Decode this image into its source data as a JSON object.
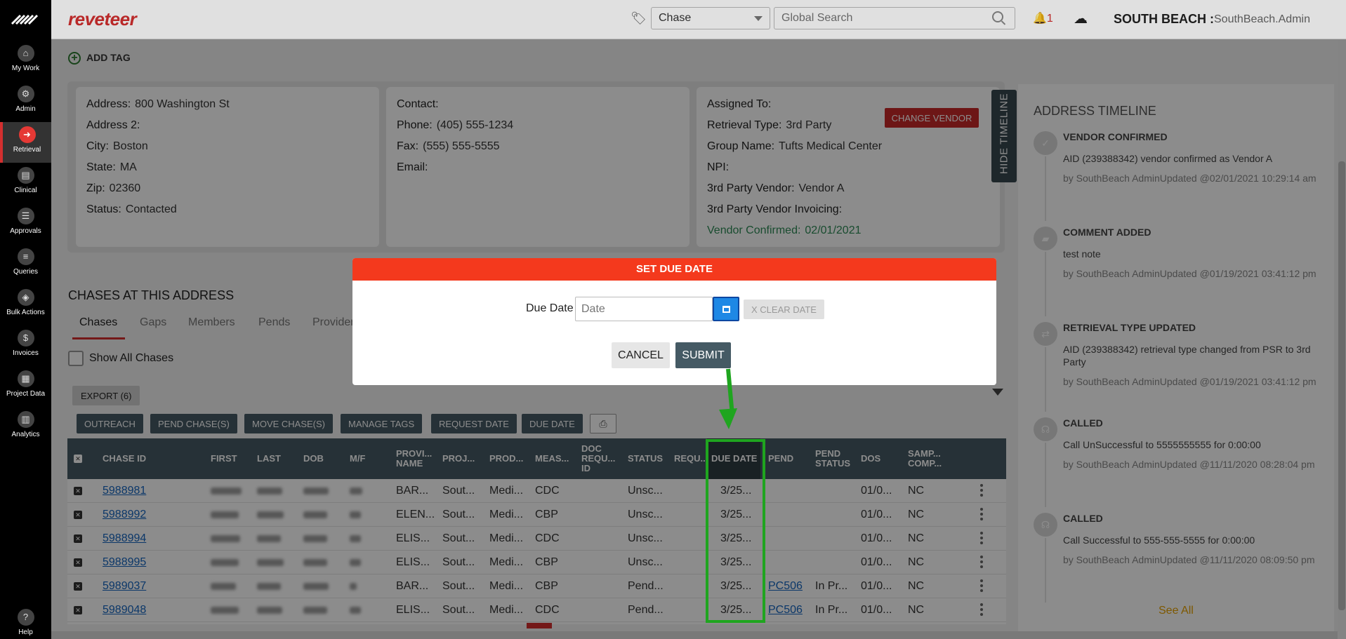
{
  "nav": {
    "items": [
      {
        "label": "My Work",
        "icon": "home-icon",
        "glyph": "⌂"
      },
      {
        "label": "Admin",
        "icon": "gear-icon",
        "glyph": "⚙"
      },
      {
        "label": "Retrieval",
        "icon": "arrow-right-icon",
        "glyph": "➜"
      },
      {
        "label": "Clinical",
        "icon": "clipboard-icon",
        "glyph": "▤"
      },
      {
        "label": "Approvals",
        "icon": "checklist-icon",
        "glyph": "☰"
      },
      {
        "label": "Queries",
        "icon": "list-icon",
        "glyph": "≡"
      },
      {
        "label": "Bulk Actions",
        "icon": "layers-icon",
        "glyph": "◈"
      },
      {
        "label": "Invoices",
        "icon": "dollar-icon",
        "glyph": "$"
      },
      {
        "label": "Project Data",
        "icon": "grid-icon",
        "glyph": "▦"
      },
      {
        "label": "Analytics",
        "icon": "bar-chart-icon",
        "glyph": "▥"
      },
      {
        "label": "Help",
        "icon": "help-icon",
        "glyph": "?"
      }
    ]
  },
  "header": {
    "brand": "reveteer",
    "search_type": "Chase",
    "search_placeholder": "Global Search",
    "notification_count": "1",
    "org": "SOUTH BEACH :",
    "user": "SouthBeach.Admin"
  },
  "add_tag": "ADD TAG",
  "address_card": [
    {
      "label": "Address:",
      "value": "800 Washington St"
    },
    {
      "label": "Address 2:",
      "value": ""
    },
    {
      "label": "City:",
      "value": "Boston"
    },
    {
      "label": "State:",
      "value": "MA"
    },
    {
      "label": "Zip:",
      "value": "02360"
    },
    {
      "label": "Status:",
      "value": "Contacted"
    }
  ],
  "contact_card": [
    {
      "label": "Contact:",
      "value": ""
    },
    {
      "label": "Phone:",
      "value": "(405) 555-1234"
    },
    {
      "label": "Fax:",
      "value": "(555) 555-5555"
    },
    {
      "label": "Email:",
      "value": ""
    }
  ],
  "vendor_card": {
    "rows": [
      {
        "label": "Assigned To:",
        "value": ""
      },
      {
        "label": "Retrieval Type:",
        "value": "3rd Party"
      },
      {
        "label": "Group Name:",
        "value": "Tufts Medical Center"
      },
      {
        "label": "NPI:",
        "value": ""
      },
      {
        "label": "3rd Party Vendor:",
        "value": "Vendor A"
      },
      {
        "label": "3rd Party Vendor Invoicing:",
        "value": ""
      }
    ],
    "confirmed_label": "Vendor Confirmed:",
    "confirmed_value": "02/01/2021",
    "change_vendor": "CHANGE VENDOR"
  },
  "hide_timeline": "HIDE TIMELINE",
  "timeline": {
    "title": "ADDRESS TIMELINE",
    "items": [
      {
        "icon": "check-icon",
        "glyph": "✓",
        "head": "VENDOR CONFIRMED",
        "desc": "AID (239388342) vendor confirmed as Vendor A",
        "by": "by SouthBeach AdminUpdated @02/01/2021 10:29:14 am"
      },
      {
        "icon": "comment-icon",
        "glyph": "▰",
        "head": "COMMENT ADDED",
        "desc": "test note",
        "by": "by SouthBeach AdminUpdated @01/19/2021 03:41:12 pm"
      },
      {
        "icon": "swap-icon",
        "glyph": "⇄",
        "head": "RETRIEVAL TYPE UPDATED",
        "desc": "AID (239388342) retrieval type changed from PSR to 3rd Party",
        "by": "by SouthBeach AdminUpdated @01/19/2021 03:41:12 pm"
      },
      {
        "icon": "headset-icon",
        "glyph": "☊",
        "head": "CALLED",
        "desc": "Call UnSuccessful to 5555555555 for 0:00:00",
        "by": "by SouthBeach AdminUpdated @11/11/2020 08:28:04 pm"
      },
      {
        "icon": "headset-icon",
        "glyph": "☊",
        "head": "CALLED",
        "desc": "Call Successful to 555-555-5555 for 0:00:00",
        "by": "by SouthBeach AdminUpdated @11/11/2020 08:09:50 pm"
      }
    ],
    "see_all": "See All"
  },
  "chases": {
    "title": "CHASES AT THIS ADDRESS",
    "tabs": [
      "Chases",
      "Gaps",
      "Members",
      "Pends",
      "Provider"
    ],
    "show_all": "Show All Chases",
    "export": "EXPORT (6)",
    "actions": [
      "OUTREACH",
      "PEND CHASE(S)",
      "MOVE CHASE(S)",
      "MANAGE TAGS",
      "REQUEST DATE",
      "DUE DATE"
    ],
    "columns": [
      "CHASE ID",
      "FIRST",
      "LAST",
      "DOB",
      "M/F",
      "PROVI... NAME",
      "PROJ...",
      "PROD...",
      "MEAS...",
      "DOC REQU... ID",
      "STATUS",
      "REQU...",
      "DUE DATE",
      "PEND",
      "PEND STATUS",
      "DOS",
      "SAMP... COMP..."
    ],
    "rows": [
      {
        "id": "5988981",
        "provider": "BAR...",
        "project": "Sout...",
        "product": "Medi...",
        "measure": "CDC",
        "status": "Unsc...",
        "due": "3/25...",
        "pend": "",
        "pend_status": "",
        "dos": "01/0...",
        "samp": "NC"
      },
      {
        "id": "5988992",
        "provider": "ELEN...",
        "project": "Sout...",
        "product": "Medi...",
        "measure": "CBP",
        "status": "Unsc...",
        "due": "3/25...",
        "pend": "",
        "pend_status": "",
        "dos": "01/0...",
        "samp": "NC"
      },
      {
        "id": "5988994",
        "provider": "ELIS...",
        "project": "Sout...",
        "product": "Medi...",
        "measure": "CDC",
        "status": "Unsc...",
        "due": "3/25...",
        "pend": "",
        "pend_status": "",
        "dos": "01/0...",
        "samp": "NC"
      },
      {
        "id": "5988995",
        "provider": "ELIS...",
        "project": "Sout...",
        "product": "Medi...",
        "measure": "CBP",
        "status": "Unsc...",
        "due": "3/25...",
        "pend": "",
        "pend_status": "",
        "dos": "01/0...",
        "samp": "NC"
      },
      {
        "id": "5989037",
        "provider": "BAR...",
        "project": "Sout...",
        "product": "Medi...",
        "measure": "CBP",
        "status": "Pend...",
        "due": "3/25...",
        "pend": "PC506",
        "pend_status": "In Pr...",
        "dos": "01/0...",
        "samp": "NC"
      },
      {
        "id": "5989048",
        "provider": "ELIS...",
        "project": "Sout...",
        "product": "Medi...",
        "measure": "CDC",
        "status": "Pend...",
        "due": "3/25...",
        "pend": "PC506",
        "pend_status": "In Pr...",
        "dos": "01/0...",
        "samp": "NC"
      }
    ]
  },
  "modal": {
    "title": "SET DUE DATE",
    "due_label": "Due Date",
    "date_placeholder": "Date",
    "clear": "X CLEAR DATE",
    "cancel": "CANCEL",
    "submit": "SUBMIT"
  },
  "colors": {
    "accent": "#d32f2f",
    "modal_header": "#f4391d",
    "highlight": "#1fa51f",
    "dark_button": "#455a64"
  }
}
